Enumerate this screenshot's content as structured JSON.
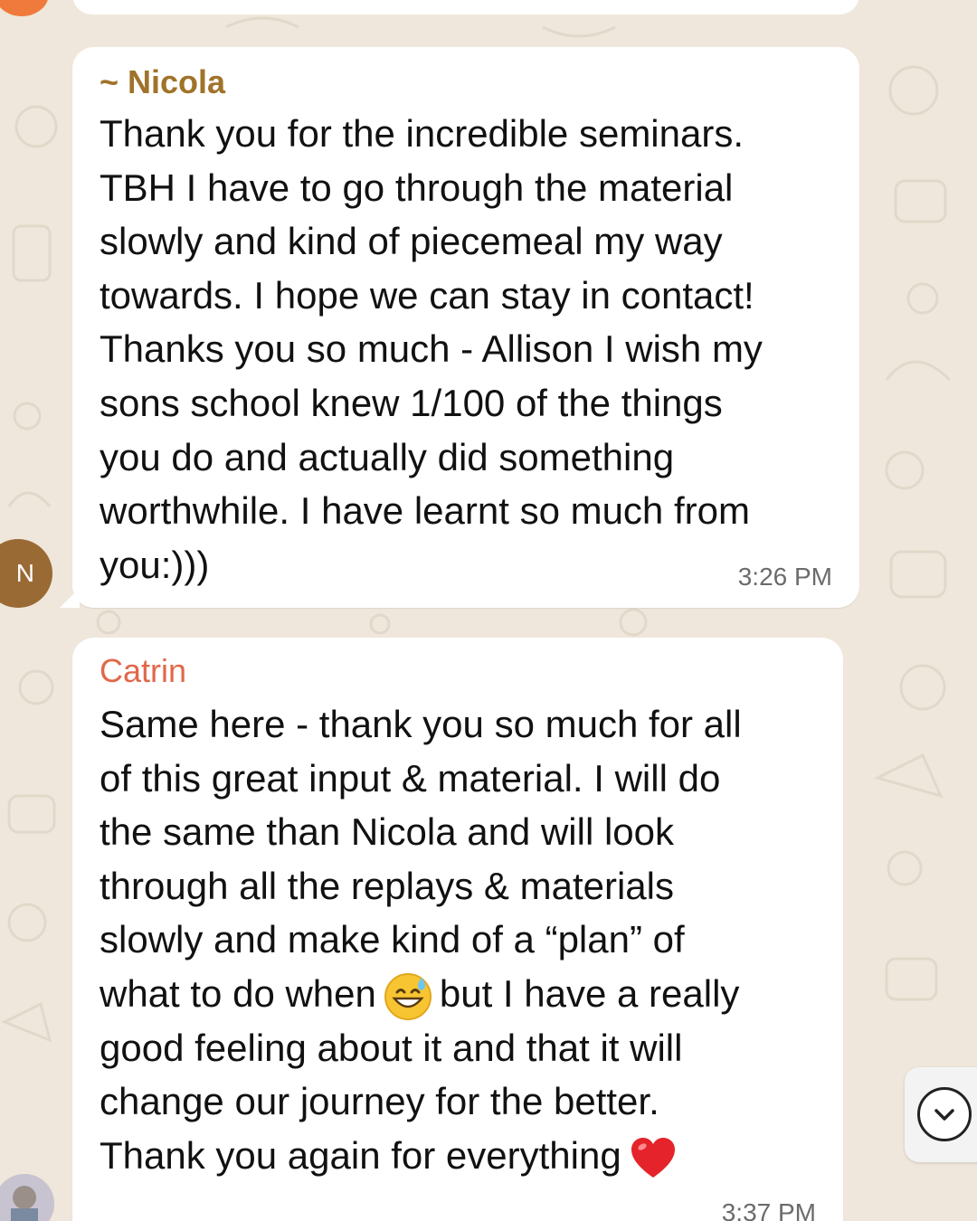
{
  "chat": {
    "messages": [
      {
        "sender": "~ Nicola",
        "sender_color": "#a0732a",
        "avatar_letter": "N",
        "avatar_color": "#9a6a35",
        "lines": [
          "Thank you for the incredible seminars.",
          "TBH I have to go through the material",
          "slowly and kind of piecemeal my way",
          "towards. I hope we can stay in contact!",
          "Thanks you so much - Allison I wish my",
          "sons school knew 1/100 of the things",
          "you do and actually did something",
          "worthwhile. I have learnt so much from",
          "you:)))"
        ],
        "time": "3:26 PM"
      },
      {
        "sender": "Catrin",
        "sender_color": "#e0684a",
        "lines": [
          "Same here - thank you so much for all",
          "of this great input & material. I will do",
          "the same than Nicola and will look",
          "through all the replays & materials",
          "slowly and make kind of a “plan” of"
        ],
        "line6_before_emoji": "what to do when",
        "line6_after_emoji": "but I have a really",
        "lines_end": [
          "good feeling about it and that it will",
          "change our journey for the better."
        ],
        "last_line": "Thank you again for everything",
        "emoji_1": "grinning-sweat-emoji",
        "emoji_2": "red-heart-emoji",
        "time": "3:37 PM"
      }
    ]
  },
  "scroll_down_button": {
    "icon": "chevron-down-icon"
  },
  "colors": {
    "wallpaper": "#efe7db",
    "bubble": "#ffffff",
    "timestamp": "#6b6b6b"
  }
}
